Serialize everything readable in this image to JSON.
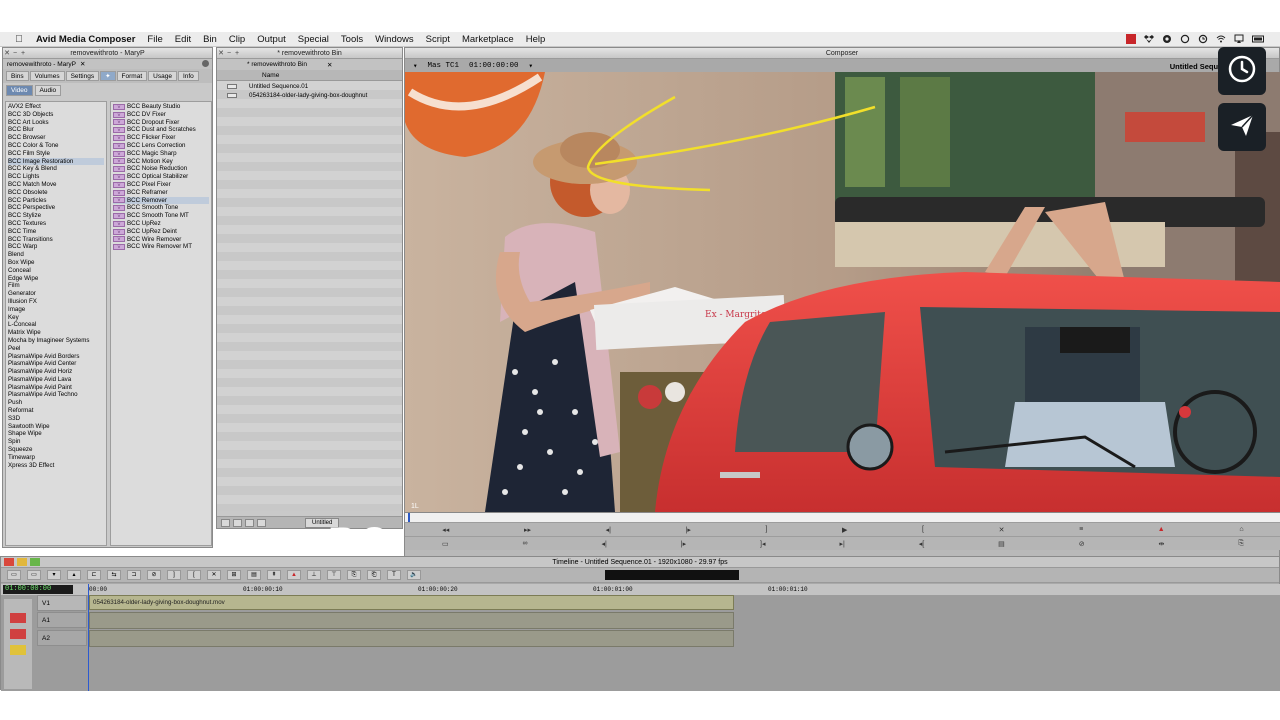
{
  "menubar": {
    "app_name": "Avid Media Composer",
    "items": [
      "File",
      "Edit",
      "Bin",
      "Clip",
      "Output",
      "Special",
      "Tools",
      "Windows",
      "Script",
      "Marketplace",
      "Help"
    ]
  },
  "project": {
    "title": "removewithroto - MaryP",
    "tab_label": "removewithroto - MaryP",
    "tabs": [
      "Bins",
      "Volumes",
      "Settings",
      "Format",
      "Usage",
      "Info"
    ],
    "subtabs": [
      "Video",
      "Audio"
    ],
    "categories": [
      "AVX2 Effect",
      "BCC 3D Objects",
      "BCC Art Looks",
      "BCC Blur",
      "BCC Browser",
      "BCC Color & Tone",
      "BCC Film Style",
      "BCC Image Restoration",
      "BCC Key & Blend",
      "BCC Lights",
      "BCC Match Move",
      "BCC Obsolete",
      "BCC Particles",
      "BCC Perspective",
      "BCC Stylize",
      "BCC Textures",
      "BCC Time",
      "BCC Transitions",
      "BCC Warp",
      "Blend",
      "Box Wipe",
      "Conceal",
      "Edge Wipe",
      "Film",
      "Generator",
      "Illusion FX",
      "Image",
      "Key",
      "L-Conceal",
      "Matrix Wipe",
      "Mocha by Imagineer Systems",
      "Peel",
      "PlasmaWipe Avid Borders",
      "PlasmaWipe Avid Center",
      "PlasmaWipe Avid Horiz",
      "PlasmaWipe Avid Lava",
      "PlasmaWipe Avid Paint",
      "PlasmaWipe Avid Techno",
      "Push",
      "Reformat",
      "S3D",
      "Sawtooth Wipe",
      "Shape Wipe",
      "Spin",
      "Squeeze",
      "Timewarp",
      "Xpress 3D Effect"
    ],
    "effects": [
      "BCC Beauty Studio",
      "BCC DV Fixer",
      "BCC Dropout Fixer",
      "BCC Dust and Scratches",
      "BCC Flicker Fixer",
      "BCC Lens Correction",
      "BCC Magic Sharp",
      "BCC Motion Key",
      "BCC Noise Reduction",
      "BCC Optical Stabilizer",
      "BCC Pixel Fixer",
      "BCC Reframer",
      "BCC Remover",
      "BCC Smooth Tone",
      "BCC Smooth Tone MT",
      "BCC UpRez",
      "BCC UpRez Deint",
      "BCC Wire Remover",
      "BCC Wire Remover MT"
    ],
    "effect_icon_text": "V"
  },
  "bin": {
    "title": "* removewithroto Bin",
    "column_name": "Name",
    "items": [
      "Untitled Sequence.01",
      "054263184-older-lady-giving-box-doughnut"
    ],
    "view_label": "Untitled"
  },
  "composer": {
    "title": "Composer",
    "timecode_label": "Mas TC1",
    "timecode": "01:00:00:00",
    "clip_name": "Untitled Sequenc",
    "box_text": "Ex - Margrite",
    "corner_label": "1L"
  },
  "background_title": "BO",
  "timeline": {
    "title": "Timeline - Untitled Sequence.01 - 1920x1080 - 29.97 fps",
    "timecode": "01:00:00:00",
    "ruler": [
      "00:00",
      "01:00:00:10",
      "01:00:00:20",
      "01:00:01:00",
      "01:00:01:10"
    ],
    "tracks": [
      "V1",
      "A1",
      "A2"
    ],
    "clip_name": "054263184-older-lady-giving-box-doughnut.mov"
  },
  "colors": {
    "annotation": "#f2df2a",
    "car": "#e8403c",
    "selection": "#2c5ad0"
  },
  "icons": {
    "history": "clock-icon",
    "send": "paper-plane-icon"
  }
}
